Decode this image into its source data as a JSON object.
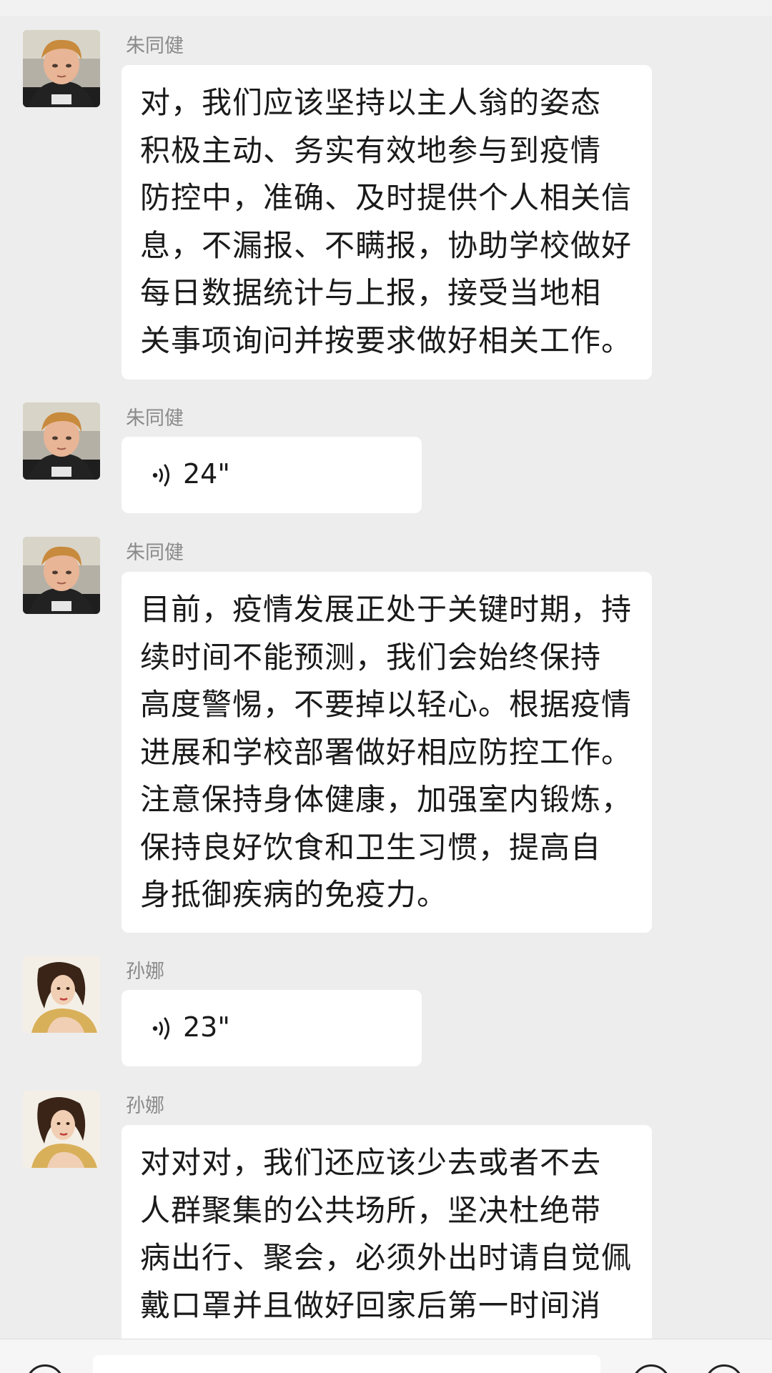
{
  "messages": [
    {
      "sender": "朱同健",
      "avatar_icon": "boy-avatar-icon",
      "type": "text",
      "text": "对，我们应该坚持以主人翁的姿态\n积极主动、务实有效地参与到疫情\n防控中，准确、及时提供个人相关信\n息，不漏报、不瞒报，协助学校做好\n每日数据统计与上报，接受当地相\n关事项询问并按要求做好相关工作。"
    },
    {
      "sender": "朱同健",
      "avatar_icon": "boy-avatar-icon",
      "type": "voice",
      "duration": "24\""
    },
    {
      "sender": "朱同健",
      "avatar_icon": "boy-avatar-icon",
      "type": "text",
      "text": "目前，疫情发展正处于关键时期，持\n续时间不能预测，我们会始终保持\n高度警惕，不要掉以轻心。根据疫情\n进展和学校部署做好相应防控工作。\n注意保持身体健康，加强室内锻炼，\n保持良好饮食和卫生习惯，提高自\n身抵御疾病的免疫力。"
    },
    {
      "sender": "孙娜",
      "avatar_icon": "princess-avatar-icon",
      "type": "voice",
      "duration": "23\""
    },
    {
      "sender": "孙娜",
      "avatar_icon": "princess-avatar-icon",
      "type": "text",
      "text": "对对对，我们还应该少去或者不去\n人群聚集的公共场所，坚决杜绝带\n病出行、聚会，必须外出时请自觉佩\n戴口罩并且做好回家后第一时间消"
    }
  ],
  "input_bar": {
    "voice_toggle_icon": "voice-toggle-icon",
    "emoji_icon": "emoji-icon",
    "plus_icon": "plus-icon"
  },
  "colors": {
    "background": "#ededed",
    "bubble": "#ffffff",
    "text": "#1a1a1a",
    "sender_name": "#8a8a8a"
  }
}
